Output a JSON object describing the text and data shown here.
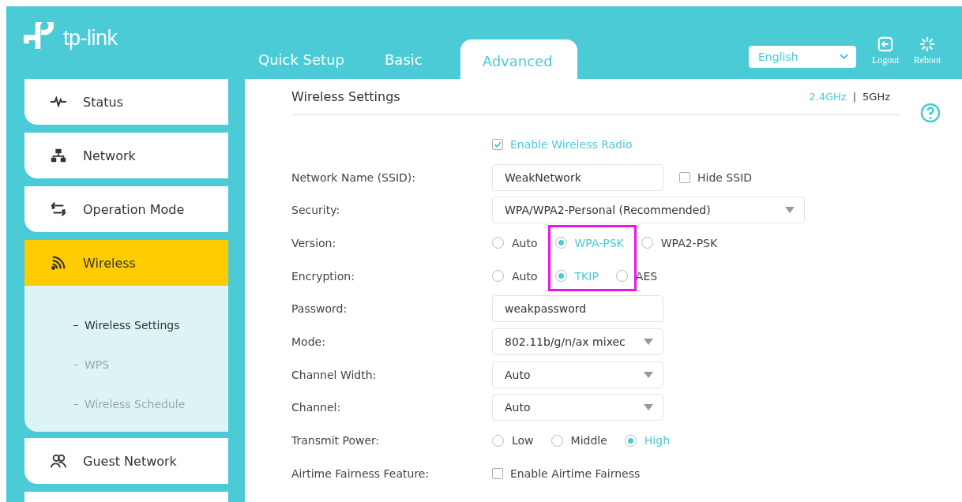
{
  "logo": {
    "text": "tp-link"
  },
  "tabs": [
    {
      "label": "Quick Setup",
      "selected": false
    },
    {
      "label": "Basic",
      "selected": false
    },
    {
      "label": "Advanced",
      "selected": true
    }
  ],
  "language": {
    "value": "English"
  },
  "actions": [
    {
      "kind": "logout",
      "label": "Logout"
    },
    {
      "kind": "reboot",
      "label": "Reboot"
    }
  ],
  "sidebar": {
    "items": [
      {
        "kind": "pulse",
        "label": "Status",
        "selected": false
      },
      {
        "kind": "network",
        "label": "Network",
        "selected": false
      },
      {
        "kind": "arrows",
        "label": "Operation Mode",
        "selected": false
      },
      {
        "kind": "wifi",
        "label": "Wireless",
        "selected": true,
        "children": [
          {
            "label": "Wireless Settings",
            "selected": true
          },
          {
            "label": "WPS",
            "selected": false
          },
          {
            "label": "Wireless Schedule",
            "selected": false
          }
        ]
      },
      {
        "kind": "people",
        "label": "Guest Network",
        "selected": false
      }
    ]
  },
  "panel": {
    "title": "Wireless Settings",
    "bands": [
      {
        "label": "2.4GHz",
        "selected": true
      },
      {
        "label": "5GHz",
        "selected": false
      }
    ],
    "band_separator": "|",
    "rows": [
      {
        "kind": "checkbox",
        "text": "Enable Wireless Radio",
        "checked": true
      },
      {
        "kind": "text",
        "label": "Network Name (SSID):",
        "value": "WeakNetwork",
        "extra": {
          "text": "Hide SSID",
          "checked": false
        }
      },
      {
        "kind": "select",
        "label": "Security:",
        "value": "WPA/WPA2-Personal (Recommended)",
        "wide": true
      },
      {
        "kind": "radio",
        "label": "Version:",
        "options": [
          {
            "label": "Auto",
            "selected": false
          },
          {
            "label": "WPA-PSK",
            "selected": true
          },
          {
            "label": "WPA2-PSK",
            "selected": false
          }
        ]
      },
      {
        "kind": "radio",
        "label": "Encryption:",
        "options": [
          {
            "label": "Auto",
            "selected": false
          },
          {
            "label": "TKIP",
            "selected": true
          },
          {
            "label": "AES",
            "selected": false
          }
        ]
      },
      {
        "kind": "text",
        "label": "Password:",
        "value": "weakpassword"
      },
      {
        "kind": "select",
        "label": "Mode:",
        "value": "802.11b/g/n/ax mixec"
      },
      {
        "kind": "select",
        "label": "Channel Width:",
        "value": "Auto"
      },
      {
        "kind": "select",
        "label": "Channel:",
        "value": "Auto"
      },
      {
        "kind": "radio",
        "label": "Transmit Power:",
        "options": [
          {
            "label": "Low",
            "selected": false
          },
          {
            "label": "Middle",
            "selected": false
          },
          {
            "label": "High",
            "selected": true
          }
        ]
      },
      {
        "kind": "checkbox",
        "label": "Airtime Fairness Feature:",
        "text": "Enable Airtime Fairness",
        "checked": false
      }
    ]
  }
}
